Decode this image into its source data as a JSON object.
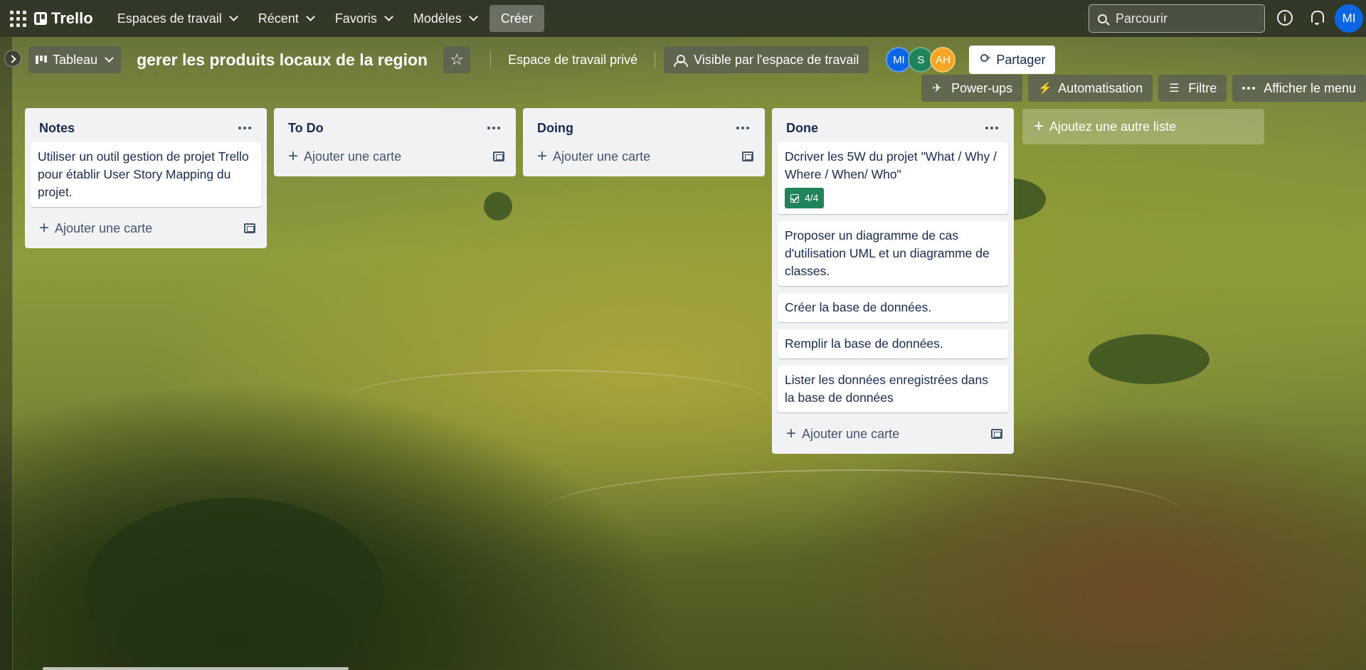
{
  "header": {
    "logo": "Trello",
    "nav": [
      "Espaces de travail",
      "Récent",
      "Favoris",
      "Modèles"
    ],
    "create_label": "Créer",
    "search_placeholder": "Parcourir",
    "info_label": "i",
    "user_initials": "MI"
  },
  "board": {
    "view_label": "Tableau",
    "title": "gerer les produits locaux de la region",
    "star": "☆",
    "workspace_label": "Espace de travail privé",
    "visibility_label": "Visible par l'espace de travail",
    "members": [
      {
        "initials": "MI",
        "color": "#0c66e4"
      },
      {
        "initials": "S",
        "color": "#1f845a"
      },
      {
        "initials": "AH",
        "color": "#f5a623"
      }
    ],
    "share_label": "Partager",
    "powerups_label": "Power-ups",
    "automation_label": "Automatisation",
    "filter_label": "Filtre",
    "menu_label": "Afficher le menu"
  },
  "lists": [
    {
      "title": "Notes",
      "cards": [
        {
          "text": "Utiliser un outil gestion de projet Trello pour établir User Story Mapping du projet."
        }
      ],
      "add_label": "Ajouter une carte"
    },
    {
      "title": "To Do",
      "cards": [],
      "add_label": "Ajouter une carte"
    },
    {
      "title": "Doing",
      "cards": [],
      "add_label": "Ajouter une carte"
    },
    {
      "title": "Done",
      "cards": [
        {
          "text": "Dcriver les 5W du projet \"What / Why / Where / When/ Who\"",
          "badge": "4/4"
        },
        {
          "text": "Proposer un diagramme de cas d'utilisation UML et un diagramme de classes."
        },
        {
          "text": "Créer la base de données."
        },
        {
          "text": "Remplir la base de données."
        },
        {
          "text": "Lister les données enregistrées dans la base de données"
        }
      ],
      "add_label": "Ajouter une carte"
    }
  ],
  "add_list_label": "Ajoutez une autre liste",
  "colors": {
    "badge_green": "#1f845a",
    "avatar_blue": "#0c66e4"
  }
}
